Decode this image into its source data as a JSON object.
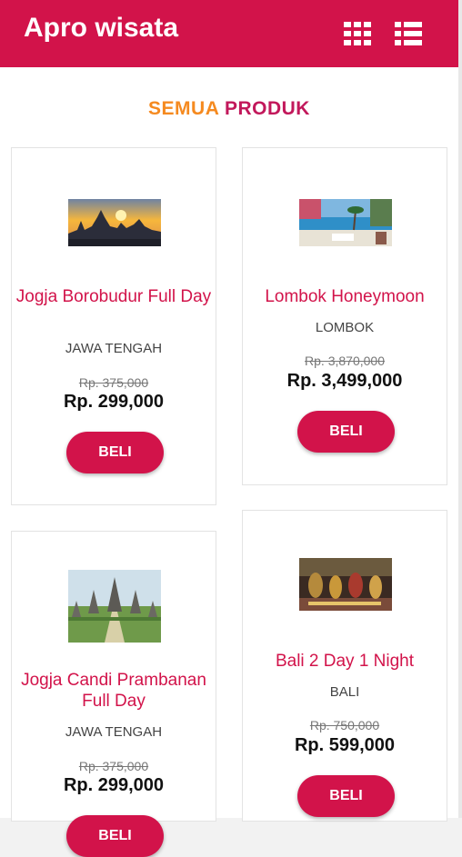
{
  "app": {
    "title": "Apro wisata"
  },
  "section": {
    "title_part1": "SEMUA",
    "title_part2": "PRODUK"
  },
  "colors": {
    "primary": "#d2134a",
    "accent_orange": "#f58a20",
    "accent_magenta": "#c2185b"
  },
  "toolbar": {
    "grid_icon": "grid-view-icon",
    "list_icon": "list-view-icon"
  },
  "products": [
    {
      "name": "Jogja Borobudur Full Day",
      "region": "JAWA TENGAH",
      "old_price": "Rp. 375,000",
      "price": "Rp. 299,000",
      "buy_label": "BELI",
      "image": "borobudur-temple-sunrise"
    },
    {
      "name": "Lombok Honeymoon",
      "region": "LOMBOK",
      "old_price": "Rp. 3,870,000",
      "price": "Rp. 3,499,000",
      "buy_label": "BELI",
      "image": "lombok-beach-collage"
    },
    {
      "name": "Jogja Candi Prambanan Full Day",
      "region": "JAWA TENGAH",
      "old_price": "Rp. 375,000",
      "price": "Rp. 299,000",
      "buy_label": "BELI",
      "image": "prambanan-temple"
    },
    {
      "name": "Bali 2 Day 1 Night",
      "region": "BALI",
      "old_price": "Rp. 750,000",
      "price": "Rp. 599,000",
      "buy_label": "BELI",
      "image": "bali-dance-performance"
    }
  ]
}
